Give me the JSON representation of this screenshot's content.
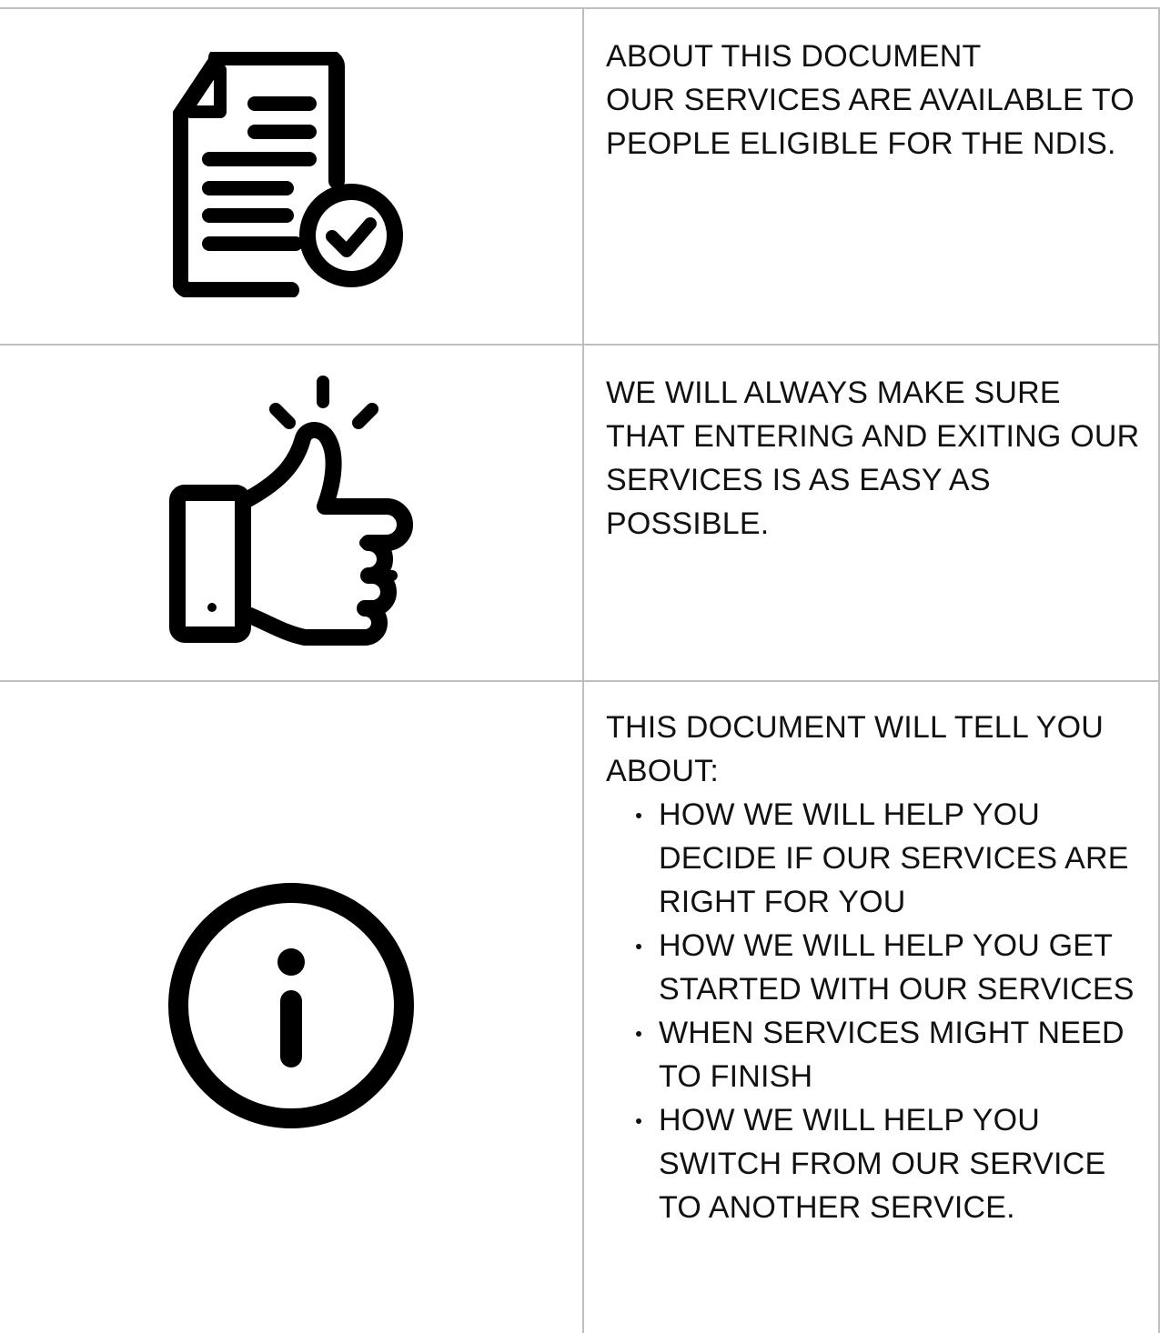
{
  "rows": [
    {
      "icon": "document-check-icon",
      "lines": [
        "ABOUT THIS DOCUMENT",
        "OUR SERVICES ARE AVAILABLE TO PEOPLE ELIGIBLE FOR THE NDIS."
      ]
    },
    {
      "icon": "thumbs-up-icon",
      "lines": [
        "WE WILL ALWAYS MAKE SURE THAT ENTERING AND EXITING OUR SERVICES IS AS EASY AS POSSIBLE."
      ]
    },
    {
      "icon": "info-icon",
      "intro": "THIS DOCUMENT WILL TELL YOU ABOUT:",
      "bullets": [
        "HOW WE WILL HELP YOU DECIDE IF OUR SERVICES ARE RIGHT FOR YOU",
        "HOW WE WILL HELP YOU GET STARTED WITH OUR SERVICES",
        "WHEN SERVICES MIGHT NEED TO FINISH",
        "HOW WE WILL HELP YOU SWITCH FROM OUR SERVICE TO ANOTHER SERVICE."
      ]
    }
  ]
}
